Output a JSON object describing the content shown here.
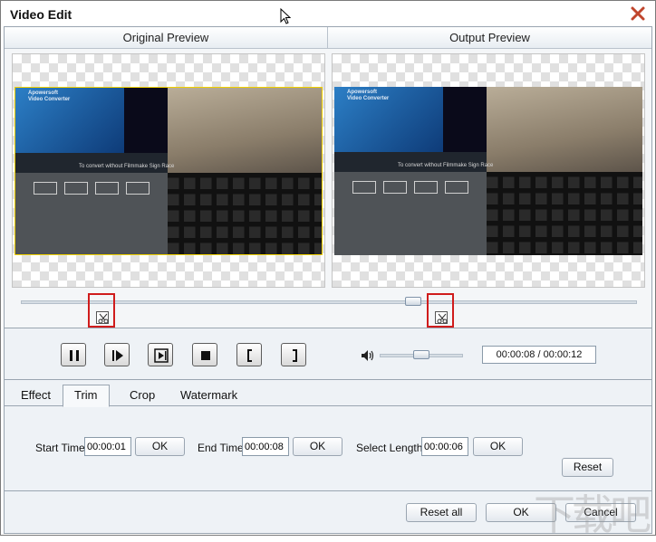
{
  "window": {
    "title": "Video Edit"
  },
  "preview": {
    "original_label": "Original Preview",
    "output_label": "Output Preview",
    "app_brand": "Apowersoft",
    "app_name": "Video Converter",
    "overlay_caption": "To convert without Filmmake Sign Race"
  },
  "playback": {
    "time": "00:00:08 / 00:00:12"
  },
  "tabs": [
    {
      "label": "Effect"
    },
    {
      "label": "Trim"
    },
    {
      "label": "Crop"
    },
    {
      "label": "Watermark"
    }
  ],
  "active_tab": "Trim",
  "trim": {
    "start_label": "Start Time",
    "start_value": "00:00:01",
    "end_label": "End Time",
    "end_value": "00:00:08",
    "length_label": "Select Length",
    "length_value": "00:00:06",
    "ok_label": "OK",
    "reset_label": "Reset"
  },
  "footer": {
    "reset_all": "Reset all",
    "ok": "OK",
    "cancel": "Cancel"
  },
  "watermark": "下载吧",
  "colors": {
    "accent_border": "#d01c1c",
    "frame_highlight": "#f0d000",
    "panel_bg": "#eef2f6"
  }
}
